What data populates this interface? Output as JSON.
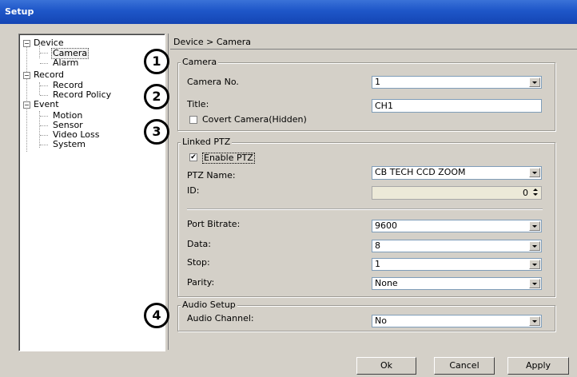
{
  "window": {
    "title": "Setup"
  },
  "tree": {
    "nodes": [
      {
        "label": "Device",
        "expander": "⊟"
      },
      {
        "label": "Camera",
        "selected": true
      },
      {
        "label": "Alarm"
      },
      {
        "label": "Record",
        "expander": "⊟"
      },
      {
        "label": "Record"
      },
      {
        "label": "Record Policy"
      },
      {
        "label": "Event",
        "expander": "⊟"
      },
      {
        "label": "Motion"
      },
      {
        "label": "Sensor"
      },
      {
        "label": "Video Loss"
      },
      {
        "label": "System"
      }
    ]
  },
  "breadcrumb": "Device > Camera",
  "camera": {
    "group_title": "Camera",
    "camera_no_label": "Camera No.",
    "camera_no_value": "1",
    "title_label": "Title:",
    "title_value": "CH1",
    "covert_label": "Covert Camera(Hidden)",
    "covert_checked": false
  },
  "ptz": {
    "group_title": "Linked PTZ",
    "enable_label": "Enable PTZ",
    "enable_checked": true,
    "name_label": "PTZ Name:",
    "name_value": "CB TECH CCD ZOOM",
    "id_label": "ID:",
    "id_value": "0",
    "bitrate_label": "Port Bitrate:",
    "bitrate_value": "9600",
    "data_label": "Data:",
    "data_value": "8",
    "stop_label": "Stop:",
    "stop_value": "1",
    "parity_label": "Parity:",
    "parity_value": "None"
  },
  "audio": {
    "group_title": "Audio Setup",
    "channel_label": "Audio Channel:",
    "channel_value": "No"
  },
  "buttons": {
    "ok": "Ok",
    "cancel": "Cancel",
    "apply": "Apply"
  },
  "callouts": [
    "1",
    "2",
    "3",
    "4"
  ],
  "checkmark": "✔"
}
